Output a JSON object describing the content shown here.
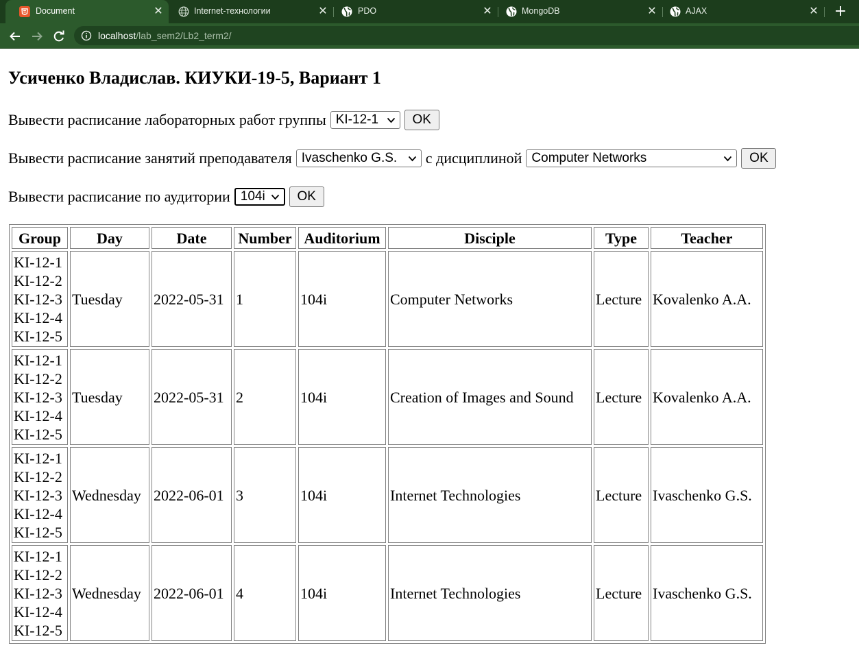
{
  "browser": {
    "tabs": [
      {
        "title": "Document",
        "icon": "html5-icon",
        "active": true
      },
      {
        "title": "Internet-технологии",
        "icon": "globe-icon",
        "active": false
      },
      {
        "title": "PDO",
        "icon": "globe-icon",
        "active": false
      },
      {
        "title": "MongoDB",
        "icon": "globe-icon",
        "active": false
      },
      {
        "title": "AJAX",
        "icon": "globe-icon",
        "active": false
      }
    ],
    "close_glyph": "✕",
    "new_tab_glyph": "+",
    "url_host": "localhost",
    "url_path": "/lab_sem2/Lb2_term2/"
  },
  "colors": {
    "tabbar_bg": "#1c3d1c",
    "toolbar_bg": "#2c5a2c",
    "html5_icon": "#e9572b"
  },
  "page": {
    "title": "Усиченко Владислав. КИУКИ-19-5, Вариант 1",
    "form_group": {
      "label": "Вывести расписание лабораторных работ группы",
      "select_value": "KI-12-1",
      "button": "OK"
    },
    "form_teacher": {
      "label": "Вывести расписание занятий преподавателя",
      "teacher_value": "Ivaschenko G.S.",
      "connector": "с дисциплиной",
      "discipline_value": "Computer Networks",
      "button": "OK"
    },
    "form_auditorium": {
      "label": "Вывести расписание по аудитории",
      "select_value": "104i",
      "button": "OK"
    }
  },
  "table": {
    "headers": {
      "group": "Group",
      "day": "Day",
      "date": "Date",
      "number": "Number",
      "auditorium": "Auditorium",
      "disciple": "Disciple",
      "type": "Type",
      "teacher": "Teacher"
    },
    "rows": [
      {
        "groups": [
          "KI-12-1",
          "KI-12-2",
          "KI-12-3",
          "KI-12-4",
          "KI-12-5"
        ],
        "day": "Tuesday",
        "date": "2022-05-31",
        "number": "1",
        "auditorium": "104i",
        "disciple": "Computer Networks",
        "type": "Lecture",
        "teacher": "Kovalenko A.A."
      },
      {
        "groups": [
          "KI-12-1",
          "KI-12-2",
          "KI-12-3",
          "KI-12-4",
          "KI-12-5"
        ],
        "day": "Tuesday",
        "date": "2022-05-31",
        "number": "2",
        "auditorium": "104i",
        "disciple": "Creation of Images and Sound",
        "type": "Lecture",
        "teacher": "Kovalenko A.A."
      },
      {
        "groups": [
          "KI-12-1",
          "KI-12-2",
          "KI-12-3",
          "KI-12-4",
          "KI-12-5"
        ],
        "day": "Wednesday",
        "date": "2022-06-01",
        "number": "3",
        "auditorium": "104i",
        "disciple": "Internet Technologies",
        "type": "Lecture",
        "teacher": "Ivaschenko G.S."
      },
      {
        "groups": [
          "KI-12-1",
          "KI-12-2",
          "KI-12-3",
          "KI-12-4",
          "KI-12-5"
        ],
        "day": "Wednesday",
        "date": "2022-06-01",
        "number": "4",
        "auditorium": "104i",
        "disciple": "Internet Technologies",
        "type": "Lecture",
        "teacher": "Ivaschenko G.S."
      }
    ]
  }
}
